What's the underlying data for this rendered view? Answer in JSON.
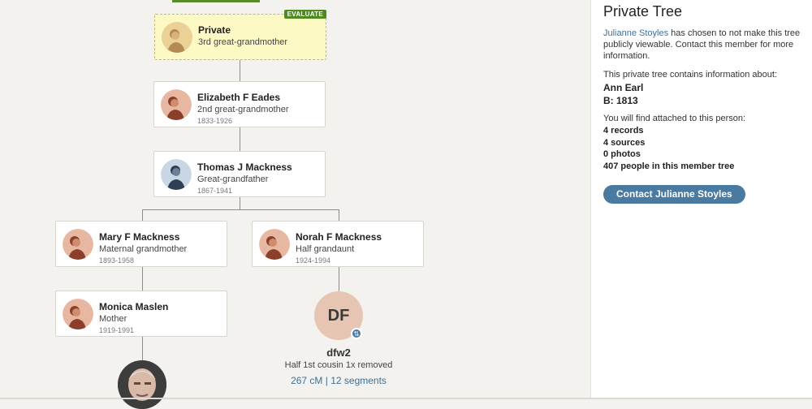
{
  "tree": {
    "private_card": {
      "name": "Private",
      "relation": "3rd great-grandmother",
      "badge": "EVALUATE"
    },
    "elizabeth": {
      "name": "Elizabeth F Eades",
      "relation": "2nd great-grandmother",
      "dates": "1833-1926"
    },
    "thomas": {
      "name": "Thomas J Mackness",
      "relation": "Great-grandfather",
      "dates": "1867-1941"
    },
    "mary": {
      "name": "Mary F Mackness",
      "relation": "Maternal grandmother",
      "dates": "1893-1958"
    },
    "norah": {
      "name": "Norah F Mackness",
      "relation": "Half grandaunt",
      "dates": "1924-1994"
    },
    "monica": {
      "name": "Monica Maslen",
      "relation": "Mother",
      "dates": "1919-1991"
    },
    "match": {
      "initials": "DF",
      "name": "dfw2",
      "relation": "Half 1st cousin 1x removed",
      "cm": "267 cM | 12 segments"
    }
  },
  "panel": {
    "title": "Private Tree",
    "owner_link": "Julianne Stoyles",
    "owner_text": " has chosen to not make this tree publicly viewable. Contact this member for more information.",
    "contains_label": "This private tree contains information about:",
    "person_name": "Ann Earl",
    "person_birth": "B: 1813",
    "attached_label": "You will find attached to this person:",
    "stats": [
      "4 records",
      "4 sources",
      "0 photos",
      "407 people in this member tree"
    ],
    "contact_button": "Contact Julianne Stoyles"
  }
}
